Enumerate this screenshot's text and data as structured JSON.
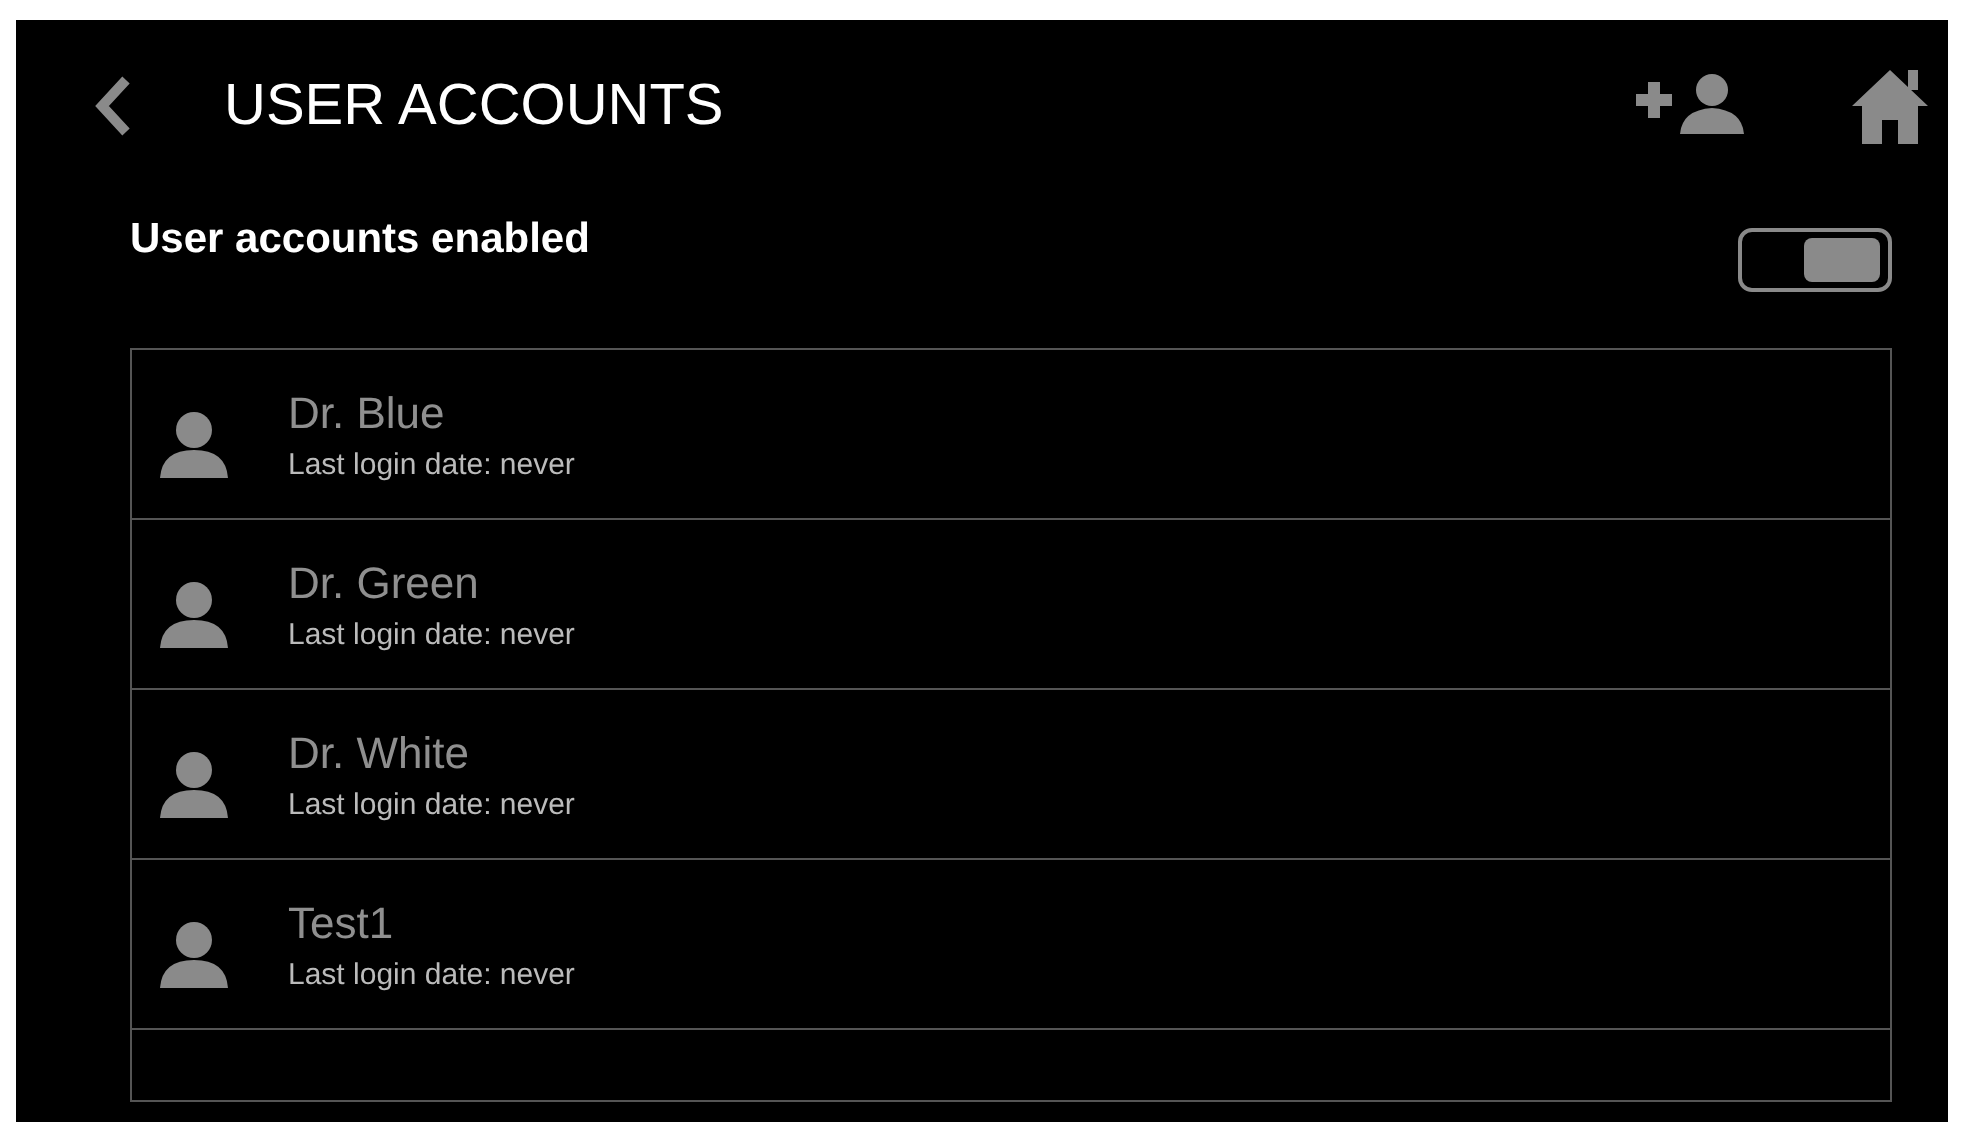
{
  "header": {
    "title": "USER ACCOUNTS"
  },
  "setting": {
    "label": "User accounts enabled",
    "on": true
  },
  "users": [
    {
      "name": "Dr. Blue",
      "detail": "Last login date: never"
    },
    {
      "name": "Dr. Green",
      "detail": "Last login date: never"
    },
    {
      "name": "Dr. White",
      "detail": "Last login date: never"
    },
    {
      "name": "Test1",
      "detail": "Last login date: never"
    }
  ]
}
